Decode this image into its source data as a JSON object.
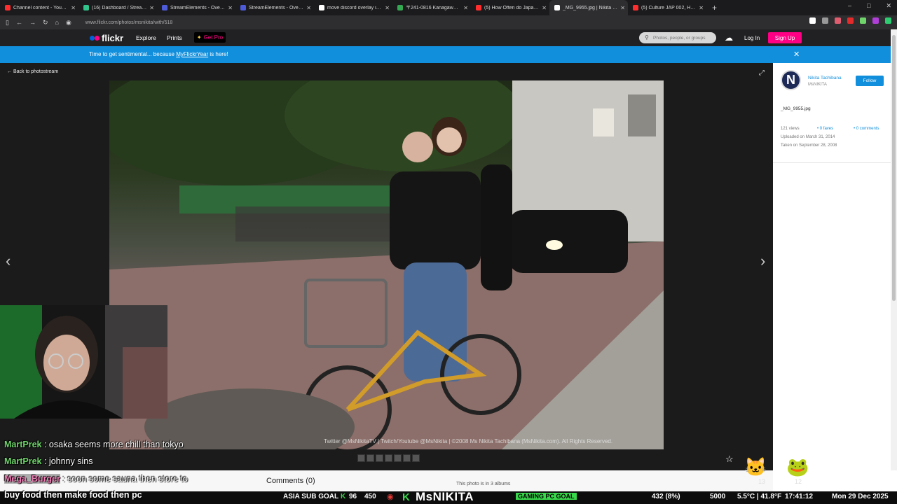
{
  "browser": {
    "tabs": [
      {
        "title": "Channel content - YouTube Stu",
        "color": "#ff2d2d"
      },
      {
        "title": "(16) Dashboard / Streamlabs",
        "color": "#31c48d"
      },
      {
        "title": "StreamElements - Overlays",
        "color": "#4e5bd8"
      },
      {
        "title": "StreamElements - Overlays",
        "color": "#4e5bd8"
      },
      {
        "title": "move discord overlay in game:",
        "color": "#ffffff"
      },
      {
        "title": "〒241-0816 Kanagawa, Yokoha",
        "color": "#34a853"
      },
      {
        "title": "(5) How Often do Japanese Pe",
        "color": "#ff2d2d"
      },
      {
        "title": "_MG_9955.jpg | Nikita Tachiban",
        "color": "#ffffff"
      },
      {
        "title": "(5) Culture JAP 002, Harajuku g",
        "color": "#ff2d2d"
      }
    ],
    "active_tab": 7,
    "url": "www.flickr.com/photos/msnikita/with/518",
    "new_tab": "+",
    "window_controls": [
      "–",
      "□",
      "✕"
    ],
    "extension_colors": [
      "#ffffff",
      "#999999",
      "#e05d6f",
      "#e32b2b",
      "#6fd46a",
      "#b03fd8",
      "#2ecc71"
    ]
  },
  "flickr": {
    "logo_text": "flickr",
    "dot_blue": "#0063dc",
    "dot_pink": "#ff0084",
    "nav": {
      "explore": "Explore",
      "prints": "Prints",
      "get_pro": "Get Pro"
    },
    "search_placeholder": "Photos, people, or groups",
    "login": "Log In",
    "signup": "Sign Up"
  },
  "banner": {
    "prefix": "Time to get sentimental... because ",
    "link": "MyFlickrYear",
    "suffix": " is here!",
    "close": "✕"
  },
  "photo_page": {
    "back": "Back to photostream",
    "credit": "Twitter @MsNikitaTV | Twitch/Youtube @MsNikita | ©2008 Ms Nikita Tachibana (MsNikita.com). All Rights Reserved.",
    "thumb_count": 7
  },
  "sidebar": {
    "avatar_letter": "N",
    "owner_name": "Nikita Tachibana",
    "owner_handle": "MsNIKITA",
    "follow": "Follow",
    "filename": "_MG_9955.jpg",
    "views": "121 views",
    "faves": "0 faves",
    "comments": "0 comments",
    "uploaded": "Uploaded on March 31, 2014",
    "taken": "Taken on September 28, 2008"
  },
  "info": {
    "comments_title": "Comments (0)",
    "albums": "This photo is in 3 albums"
  },
  "stream": {
    "chat": [
      {
        "user": "MartPrek",
        "message": " : osaka seems more chill than tokyo"
      },
      {
        "user": "MartPrek",
        "message": " : johnny sins"
      },
      {
        "user": "Mega_Burger",
        "message": " : soon some sauna then store to",
        "continuation": "buy food then make food then pc"
      }
    ],
    "asia_goal_label": "ASIA SUB GOAL",
    "asia_current": "96",
    "asia_target": "450",
    "channel_name": "MsNIKITA",
    "pc_goal_label": "GAMING PC GOAL",
    "pc_progress": "432 (8%)",
    "pc_target": "5000",
    "temperature": "5.5°C | 41.8°F",
    "time": "17:41:12",
    "date": "Mon 29 Dec 2025",
    "emote1_count": "13",
    "emote2_count": "12"
  }
}
